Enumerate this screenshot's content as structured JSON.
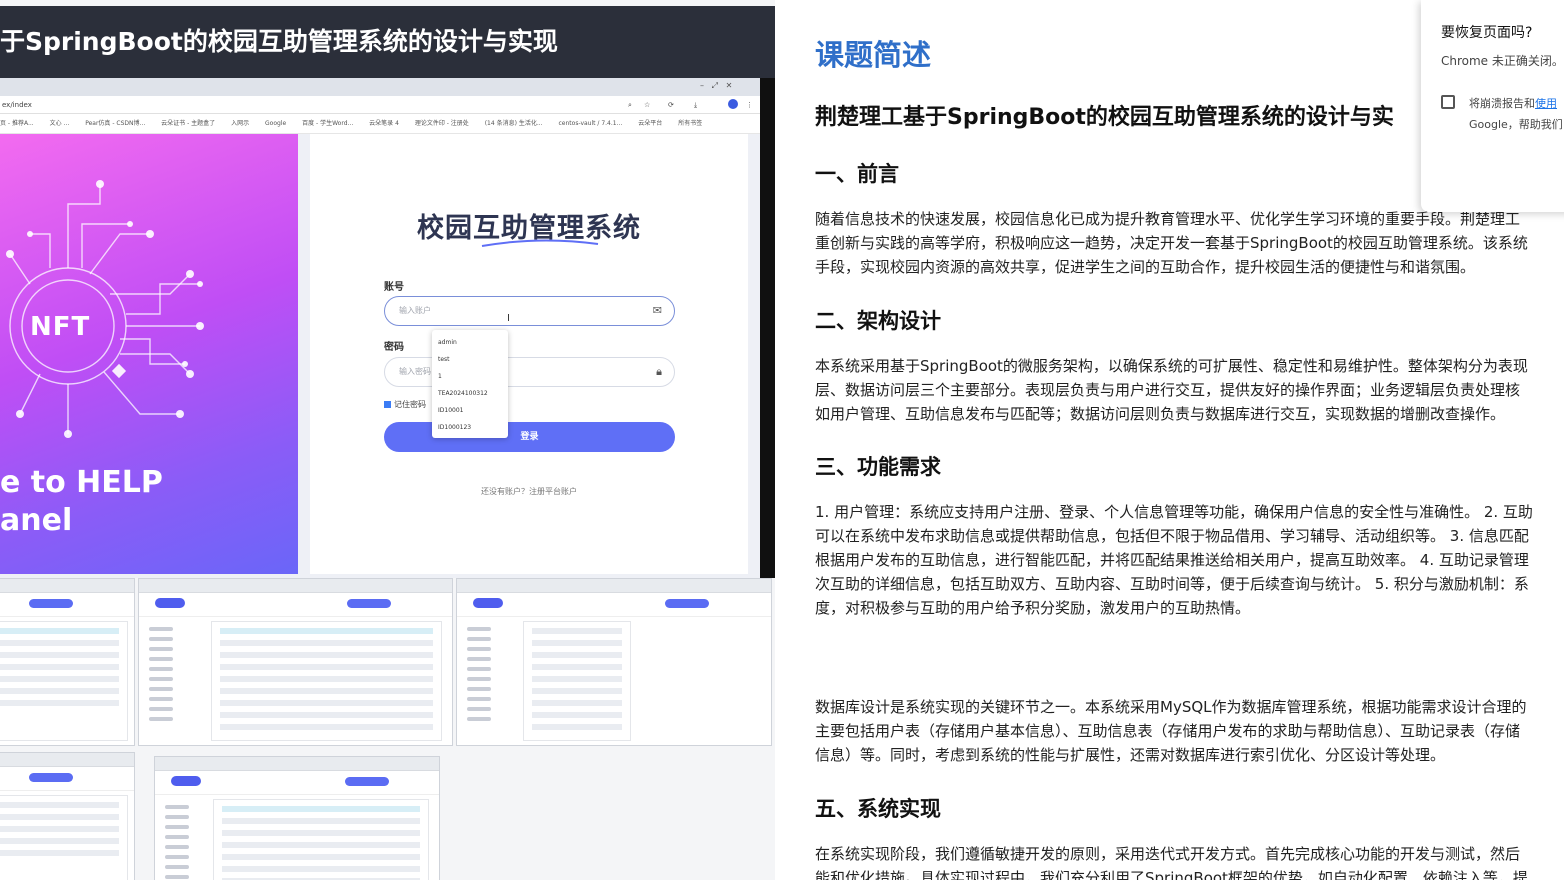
{
  "left_panel": {
    "banner_title": "于SpringBoot的校园互助管理系统的设计与实现",
    "browser": {
      "address": "ex/index",
      "bookmarks": [
        "页 - 推荐A...",
        "文心 ...",
        "Pear仿真 - CSDN博...",
        "云朵证书 - 主题盒了",
        "入网示",
        "Google",
        "百度 - 学生Word...",
        "云朵笔录 4",
        "理论文件印 - 注册处",
        "(14 条消息) 生活化...",
        "centos-vault / 7.4.1...",
        "云朵平台",
        "所有书签"
      ]
    },
    "hero": {
      "badge": "NFT",
      "welcome_line1": "e to HELP",
      "welcome_line2": "anel"
    },
    "login": {
      "title": "校园互助管理系统",
      "account_label": "账号",
      "account_placeholder": "输入账户",
      "password_label": "密码",
      "password_placeholder": "输入密码",
      "remember_label": "记住密码",
      "login_button": "登录",
      "register_link": "还没有账户？注册平台账户"
    },
    "autocomplete_options": [
      "admin",
      "test",
      "1",
      "TEA2024100312",
      "ID10001",
      "ID1000123"
    ]
  },
  "right_panel": {
    "heading": "课题简述",
    "subtitle": "荆楚理工基于SpringBoot的校园互助管理系统的设计与实",
    "sections": [
      {
        "title": "一、前言",
        "lines": [
          "随着信息技术的快速发展，校园信息化已成为提升教育管理水平、优化学生学习环境的重要手段。荆楚理工",
          "重创新与实践的高等学府，积极响应这一趋势，决定开发一套基于SpringBoot的校园互助管理系统。该系统",
          "手段，实现校园内资源的高效共享，促进学生之间的互助合作，提升校园生活的便捷性与和谐氛围。"
        ]
      },
      {
        "title": "二、架构设计",
        "lines": [
          "本系统采用基于SpringBoot的微服务架构，以确保系统的可扩展性、稳定性和易维护性。整体架构分为表现",
          "层、数据访问层三个主要部分。表现层负责与用户进行交互，提供友好的操作界面；业务逻辑层负责处理核",
          "如用户管理、互助信息发布与匹配等；数据访问层则负责与数据库进行交互，实现数据的增删改查操作。"
        ]
      },
      {
        "title": "三、功能需求",
        "lines": [
          "1. 用户管理：系统应支持用户注册、登录、个人信息管理等功能，确保用户信息的安全性与准确性。 2. 互助",
          "可以在系统中发布求助信息或提供帮助信息，包括但不限于物品借用、学习辅导、活动组织等。 3. 信息匹配",
          "根据用户发布的互助信息，进行智能匹配，并将匹配结果推送给相关用户，提高互助效率。 4. 互助记录管理",
          "次互助的详细信息，包括互助双方、互助内容、互助时间等，便于后续查询与统计。 5. 积分与激励机制：系",
          "度，对积极参与互助的用户给予积分奖励，激发用户的互助热情。"
        ]
      },
      {
        "title": "",
        "lines": [
          "数据库设计是系统实现的关键环节之一。本系统采用MySQL作为数据库管理系统，根据功能需求设计合理的",
          "主要包括用户表（存储用户基本信息）、互助信息表（存储用户发布的求助与帮助信息）、互助记录表（存储",
          "信息）等。同时，考虑到系统的性能与扩展性，还需对数据库进行索引优化、分区设计等处理。"
        ]
      },
      {
        "title": "五、系统实现",
        "lines": [
          "在系统实现阶段，我们遵循敏捷开发的原则，采用迭代式开发方式。首先完成核心功能的开发与测试，然后",
          "能和优化措施。具体实现过程中，我们充分利用了SpringBoot框架的优势，如自动化配置、依赖注入等，提"
        ]
      }
    ]
  },
  "restore_popup": {
    "question": "要恢复页面吗?",
    "detail": "Chrome 未正确关闭。",
    "report_prefix": "将崩溃报告和",
    "report_link": "使用",
    "report_suffix": "Google，帮助我们"
  },
  "colors": {
    "heading_blue": "#2f6fc9",
    "login_button": "#5f6ff6",
    "banner_bg": "#2b2f3a"
  },
  "icons": [
    "mail-icon",
    "lock-icon",
    "search-icon",
    "star-icon",
    "text-cursor-icon",
    "checkbox-icon"
  ]
}
